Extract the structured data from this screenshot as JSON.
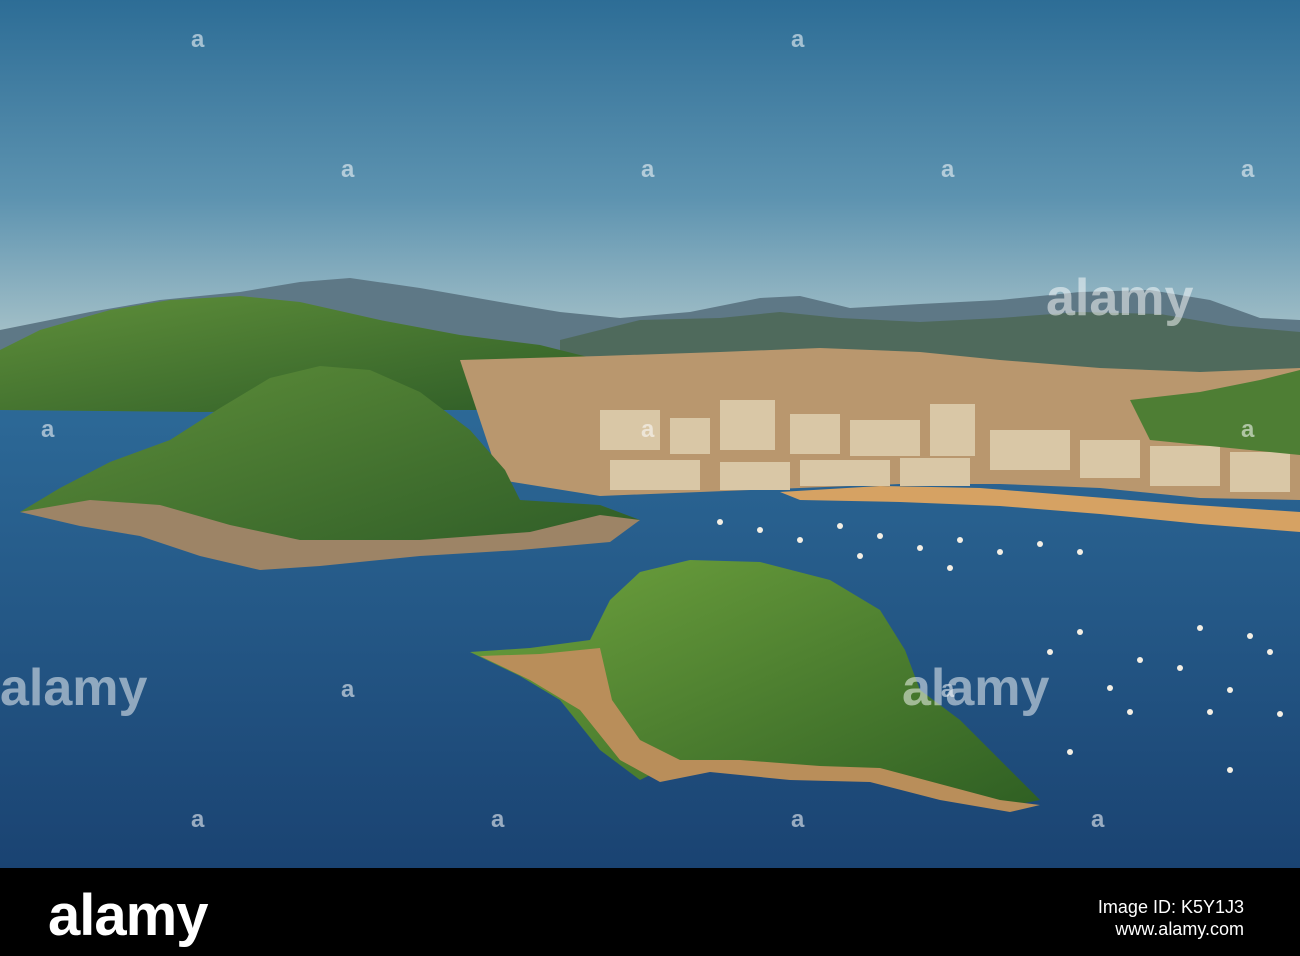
{
  "scene": {
    "subject": "Aerial view of bay with two green islands, city waterfront and anchored sailboats",
    "colors": {
      "sky_top": "#2e6e97",
      "sky_horizon": "#a9c5cf",
      "sea": "#1d4f80",
      "vegetation": "#3f7a2c",
      "sand": "#d8a25c"
    }
  },
  "watermark": {
    "text": "alamy",
    "marks": [
      "a",
      "a",
      "a",
      "a",
      "a",
      "a",
      "a",
      "a",
      "a",
      "a",
      "a",
      "a",
      "a",
      "a",
      "a"
    ]
  },
  "footer": {
    "brand": "alamy",
    "image_id": "Image ID: K5Y1J3",
    "url": "www.alamy.com"
  }
}
